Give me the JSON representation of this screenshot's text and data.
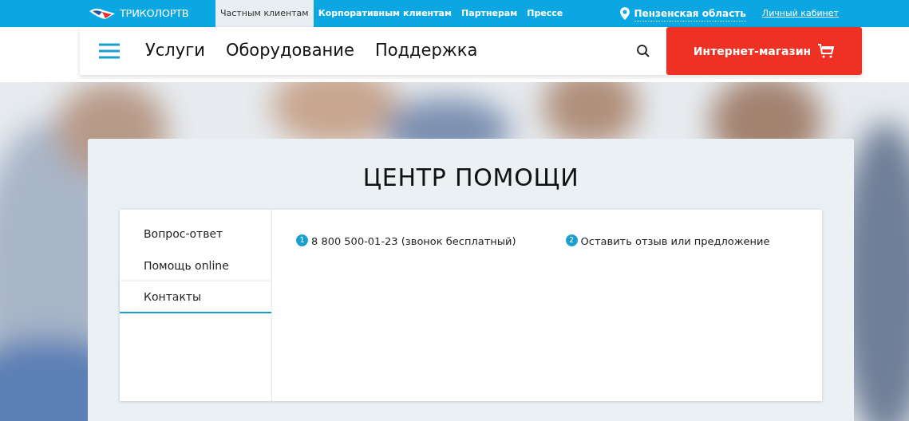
{
  "top_bar": {
    "logo": "ТРИКОЛОРТВ",
    "segments": [
      {
        "label": "Частным клиентам",
        "selected": true
      },
      {
        "label": "Корпоративным клиентам",
        "selected": false
      },
      {
        "label": "Партнерам",
        "selected": false
      },
      {
        "label": "Прессе",
        "selected": false
      }
    ],
    "region": "Пензенская область",
    "account_link": "Личный кабинет"
  },
  "nav": {
    "items": [
      "Услуги",
      "Оборудование",
      "Поддержка"
    ],
    "shop_button": "Интернет-магазин"
  },
  "help_center": {
    "title": "ЦЕНТР ПОМОЩИ",
    "menu": [
      {
        "label": "Вопрос-ответ",
        "selected": false
      },
      {
        "label": "Помощь online",
        "selected": false
      },
      {
        "label": "Контакты",
        "selected": true
      }
    ],
    "contacts": [
      {
        "number": "1",
        "text": "8 800 500-01-23 (звонок бесплатный)"
      },
      {
        "number": "2",
        "text": "Оставить отзыв или предложение"
      }
    ]
  }
}
